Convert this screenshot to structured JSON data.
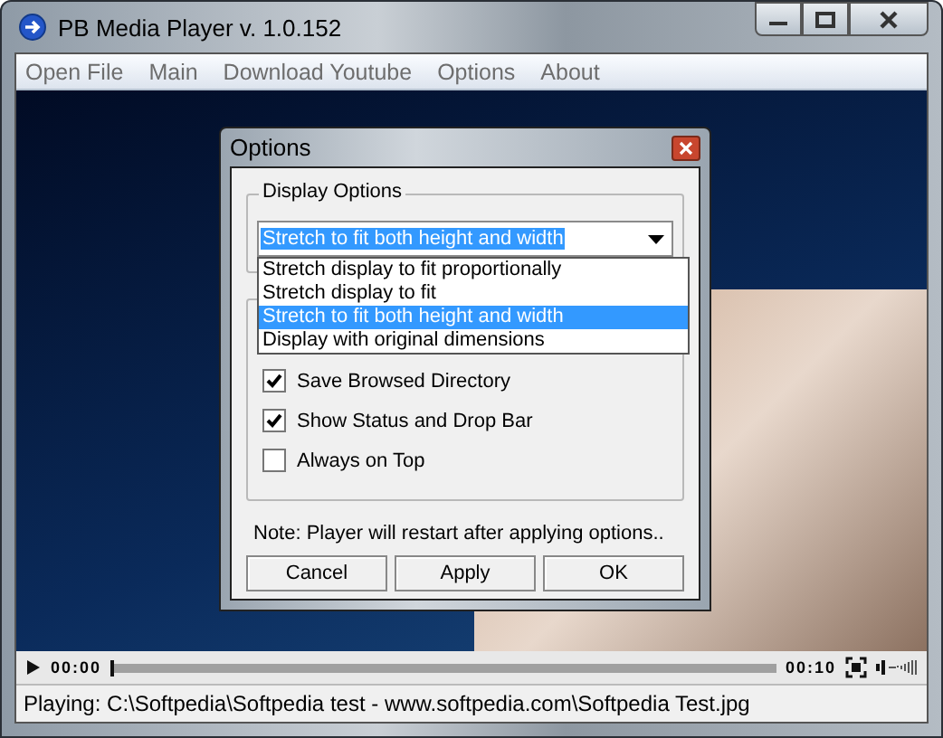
{
  "window": {
    "title": "PB Media Player v. 1.0.152"
  },
  "menu": [
    "Open File",
    "Main",
    "Download Youtube",
    "Options",
    "About"
  ],
  "dialog": {
    "title": "Options",
    "group_title": "Display Options",
    "dropdown": {
      "value": "Stretch to fit both height and width",
      "expanded": true,
      "options": [
        {
          "label": "Stretch display to fit proportionally",
          "selected": false
        },
        {
          "label": "Stretch display to fit",
          "selected": false
        },
        {
          "label": "Stretch to fit both height and width",
          "selected": true
        },
        {
          "label": "Display with original dimensions",
          "selected": false
        }
      ]
    },
    "checkboxes": [
      {
        "label": "Save Browsed Directory",
        "checked": true
      },
      {
        "label": "Show Status and Drop Bar",
        "checked": true
      },
      {
        "label": "Always on Top",
        "checked": false
      }
    ],
    "note": "Note: Player will restart after applying options..",
    "buttons": [
      "Cancel",
      "Apply",
      "OK"
    ]
  },
  "player": {
    "time_elapsed": "00:00",
    "time_total": "00:10",
    "level": 0
  },
  "status_bar": "Playing: C:\\Softpedia\\Softpedia test - www.softpedia.com\\Softpedia Test.jpg"
}
